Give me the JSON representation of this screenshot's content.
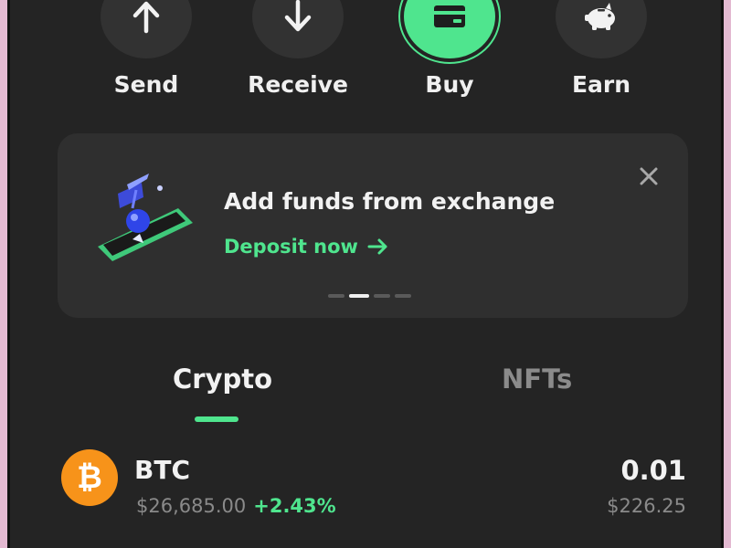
{
  "colors": {
    "background": "#242424",
    "card": "#2f2f2f",
    "accent": "#4fe58e",
    "muted_text": "#8a8a8a",
    "btc_orange": "#f7931a",
    "frame": "#e3b9d1"
  },
  "actions": [
    {
      "label": "Send",
      "icon": "arrow-up-icon"
    },
    {
      "label": "Receive",
      "icon": "arrow-down-icon"
    },
    {
      "label": "Buy",
      "icon": "card-icon"
    },
    {
      "label": "Earn",
      "icon": "piggy-bank-icon"
    }
  ],
  "promo": {
    "title": "Add funds from exchange",
    "cta": "Deposit now",
    "cta_icon": "arrow-right-icon",
    "close_icon": "close-icon",
    "page_count": 4,
    "active_page": 2
  },
  "tabs": [
    {
      "label": "Crypto",
      "active": true
    },
    {
      "label": "NFTs",
      "active": false
    }
  ],
  "assets": [
    {
      "symbol": "BTC",
      "icon": "bitcoin-icon",
      "icon_glyph": "₿",
      "price": "$26,685.00",
      "change": "+2.43%",
      "amount": "0.01",
      "fiat_value": "$226.25"
    }
  ]
}
